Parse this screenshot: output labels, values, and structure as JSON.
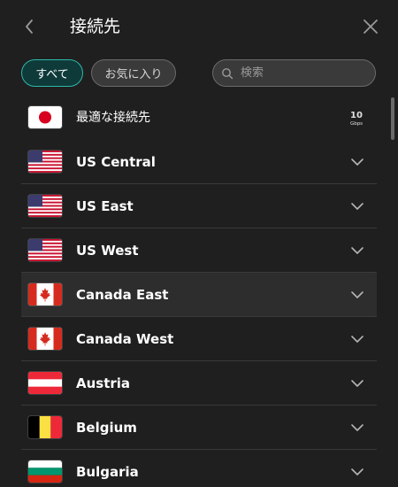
{
  "header": {
    "title": "接続先",
    "back_icon": "chevron-left-icon",
    "close_icon": "close-icon"
  },
  "filters": {
    "all_label": "すべて",
    "favorites_label": "お気に入り"
  },
  "search": {
    "placeholder": "検索",
    "value": ""
  },
  "list": {
    "best": {
      "label": "最適な接続先",
      "flag": "japan-flag",
      "badge_top": "10",
      "badge_bottom": "Gbps"
    },
    "items": [
      {
        "label": "US Central",
        "flag": "us-flag"
      },
      {
        "label": "US East",
        "flag": "us-flag"
      },
      {
        "label": "US West",
        "flag": "us-flag"
      },
      {
        "label": "Canada East",
        "flag": "canada-flag"
      },
      {
        "label": "Canada West",
        "flag": "canada-flag"
      },
      {
        "label": "Austria",
        "flag": "austria-flag"
      },
      {
        "label": "Belgium",
        "flag": "belgium-flag"
      },
      {
        "label": "Bulgaria",
        "flag": "bulgaria-flag"
      }
    ]
  },
  "colors": {
    "background": "#1f1f1f",
    "accent": "#2fb7a8",
    "divider": "#3a3a3a",
    "hover_row": "#2d2d2d"
  }
}
